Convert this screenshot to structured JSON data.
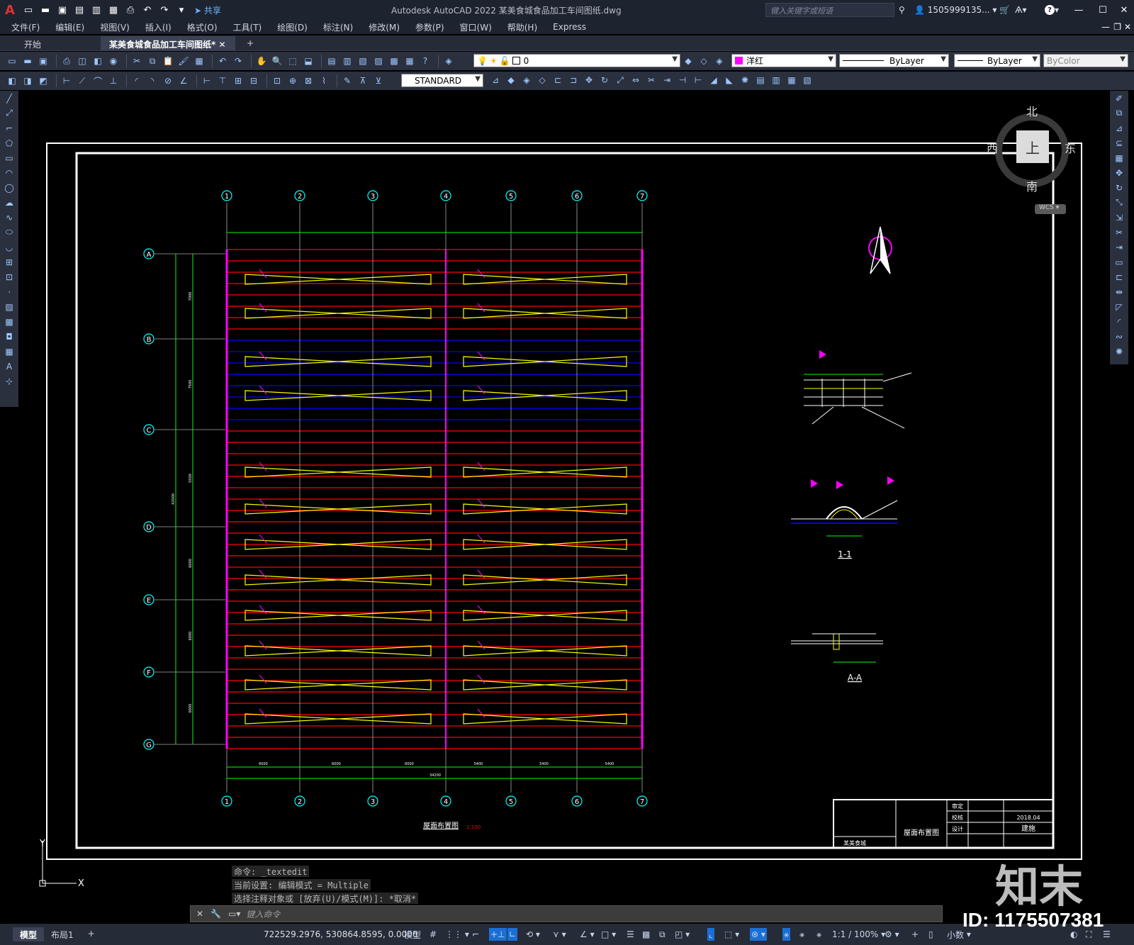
{
  "titlebar": {
    "share_label": "共享",
    "window_title": "Autodesk AutoCAD 2022    某美食城食品加工车间图纸.dwg",
    "search_placeholder": "键入关键字或短语",
    "user": "1505999135...",
    "help": "?"
  },
  "menu": [
    "文件(F)",
    "编辑(E)",
    "视图(V)",
    "插入(I)",
    "格式(O)",
    "工具(T)",
    "绘图(D)",
    "标注(N)",
    "修改(M)",
    "参数(P)",
    "窗口(W)",
    "帮助(H)",
    "Express"
  ],
  "tabs": {
    "start": "开始",
    "active": "某美食城食品加工车间图纸*",
    "add": "+"
  },
  "properties": {
    "layer": "0",
    "color_name": "洋红",
    "color": "#ff00ff",
    "linetype": "ByLayer",
    "lineweight": "ByLayer",
    "plotstyle": "ByColor",
    "textstyle": "STANDARD"
  },
  "viewcube": {
    "north": "北",
    "south": "南",
    "east": "东",
    "west": "西",
    "face": "上",
    "wcs": "WCS"
  },
  "drawing": {
    "column_axes": [
      "1",
      "2",
      "3",
      "4",
      "5",
      "6",
      "7"
    ],
    "row_axes": [
      "A",
      "B",
      "C",
      "D",
      "E",
      "F",
      "G"
    ],
    "bottom_dims": [
      "6000",
      "6000",
      "6000",
      "5400",
      "5400",
      "5400"
    ],
    "total_width": "34200",
    "total_height": "42000",
    "left_dims": [
      "7000",
      "7500",
      "5500",
      "6000",
      "6000",
      "6000"
    ],
    "plan_title": "屋面布置图",
    "plan_scale": "1:100",
    "section_1": "1-1",
    "section_a": "A-A",
    "tb_project": "屋面布置图",
    "tb_design": "设计",
    "tb_check": "校核",
    "tb_approve": "审定",
    "tb_date": "2018.04",
    "tb_spec": "建施",
    "tb_client": "某美食城"
  },
  "command": {
    "line1": "命令: _textedit",
    "line2": "当前设置: 编辑模式 = Multiple",
    "line3": "选择注释对象或 [放弃(U)/模式(M)]: *取消*",
    "placeholder": "键入命令"
  },
  "statusbar": {
    "model_tab": "模型",
    "layout_tab": "布局1",
    "add": "+",
    "coords": "722529.2976, 530864.8595, 0.0000",
    "model_label": "模型",
    "scale": "1:1 / 100%",
    "units": "小数"
  },
  "watermark": {
    "logo": "知末",
    "id": "ID: 1175507381"
  }
}
